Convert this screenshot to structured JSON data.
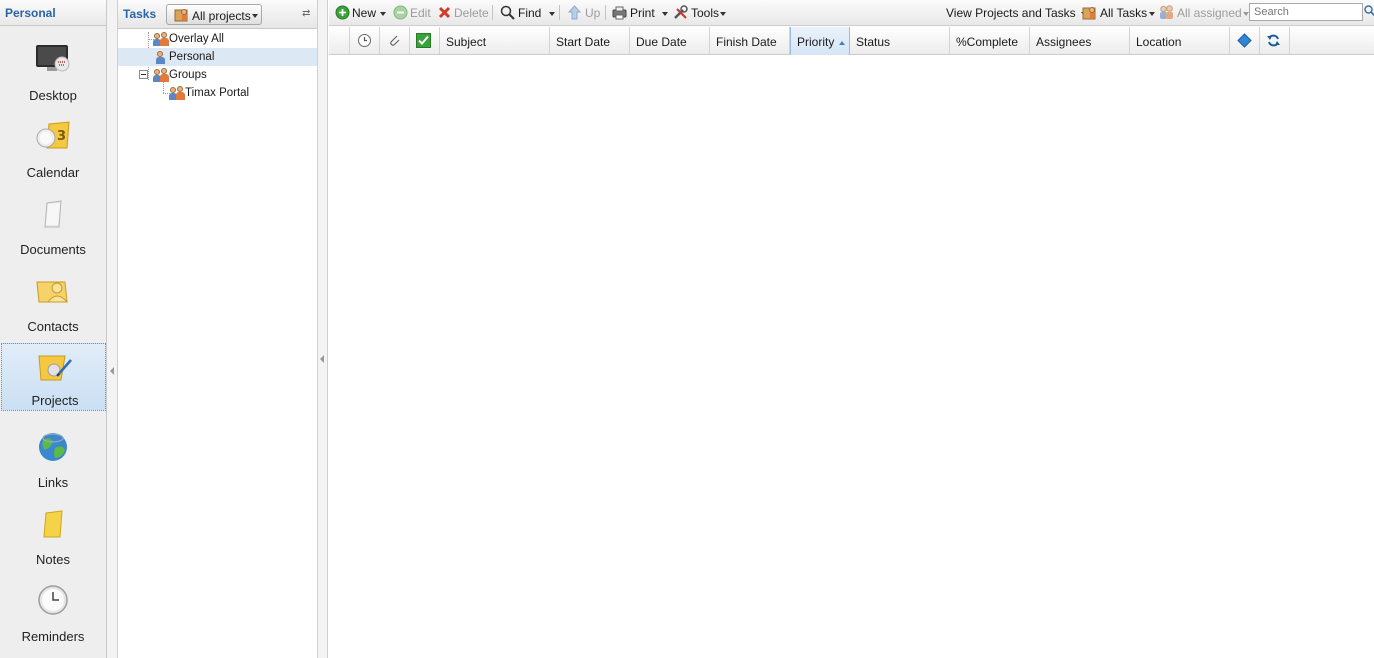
{
  "nav": {
    "header": "Personal",
    "items": [
      {
        "label": "Desktop",
        "icon": "desktop-icon"
      },
      {
        "label": "Calendar",
        "icon": "calendar-icon"
      },
      {
        "label": "Documents",
        "icon": "documents-icon"
      },
      {
        "label": "Contacts",
        "icon": "contacts-icon"
      },
      {
        "label": "Projects",
        "icon": "projects-icon",
        "active": true
      },
      {
        "label": "Links",
        "icon": "globe-icon"
      },
      {
        "label": "Notes",
        "icon": "notes-icon"
      },
      {
        "label": "Reminders",
        "icon": "clock-icon"
      }
    ]
  },
  "tree": {
    "title": "Tasks",
    "projects_button": "All projects",
    "rows": [
      {
        "label": "Overlay All",
        "icon": "group-icon"
      },
      {
        "label": "Personal",
        "icon": "person-icon",
        "selected": true
      },
      {
        "label": "Groups",
        "icon": "group-icon",
        "expanded": true
      },
      {
        "label": "Timax Portal",
        "icon": "group-icon"
      }
    ]
  },
  "toolbar": {
    "new": "New",
    "edit": "Edit",
    "delete": "Delete",
    "find": "Find",
    "up": "Up",
    "print": "Print",
    "tools": "Tools",
    "view_projects": "View Projects and Tasks",
    "all_tasks": "All Tasks",
    "all_assigned": "All assigned",
    "search_placeholder": "Search"
  },
  "grid": {
    "columns": [
      "Subject",
      "Start Date",
      "Due Date",
      "Finish Date",
      "Priority",
      "Status",
      "%Complete",
      "Assignees",
      "Location"
    ],
    "sorted_column": "Priority",
    "sort_direction": "ascending",
    "rows": []
  },
  "colors": {
    "accent": "#2a64a8",
    "selection": "#dde8f5",
    "add_green": "#3aa23a",
    "delete_red": "#d23a2a"
  }
}
